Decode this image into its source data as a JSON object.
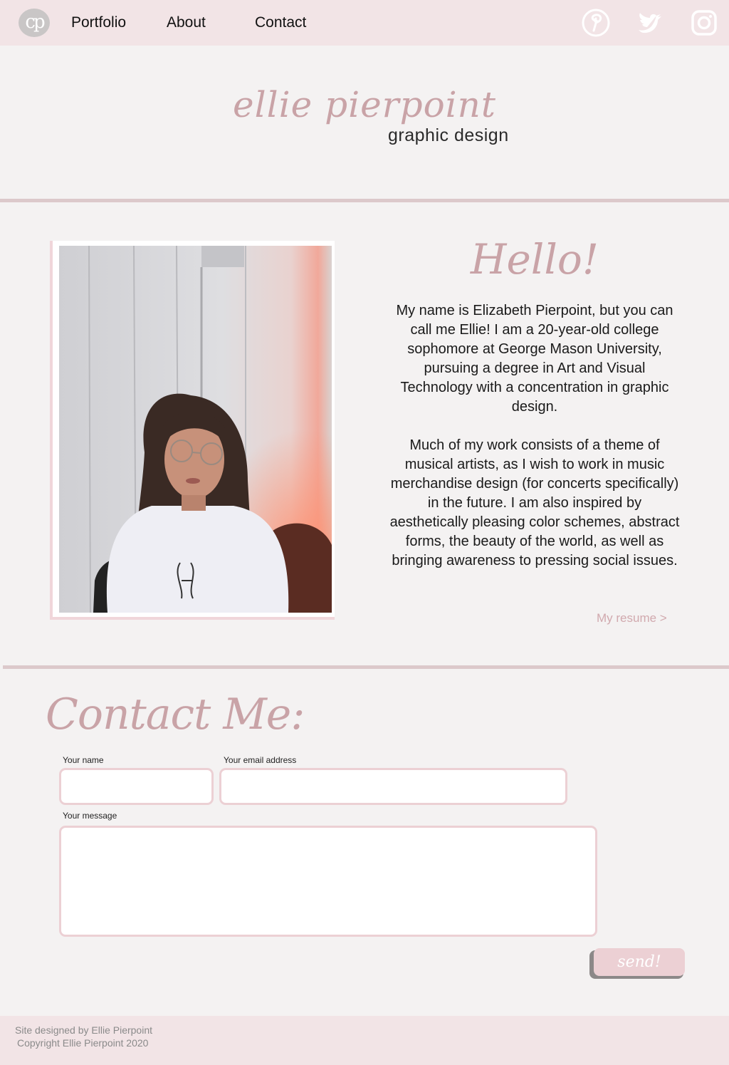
{
  "nav": {
    "logo_text": "cp",
    "links": [
      "Portfolio",
      "About",
      "Contact"
    ],
    "social": [
      "pinterest-icon",
      "twitter-icon",
      "instagram-icon"
    ]
  },
  "header": {
    "name": "ellie pierpoint",
    "subtitle": "graphic design"
  },
  "about": {
    "heading": "Hello!",
    "paragraph_1": "My name is Elizabeth Pierpoint, but you can call me Ellie! I am a 20-year-old college sophomore at George Mason University, pursuing a degree in Art and Visual Technology with a concentration in graphic design.",
    "paragraph_2": "Much of my work consists of a theme of musical artists, as I wish to work in music merchandise design (for concerts specifically) in the future. I am also inspired by aesthetically pleasing color schemes, abstract forms, the beauty of the world, as well as bringing awareness to pressing social issues.",
    "resume_link": "My resume  >"
  },
  "contact": {
    "title": "Contact Me:",
    "name_label": "Your name",
    "email_label": "Your email address",
    "message_label": "Your message",
    "name_value": "",
    "email_value": "",
    "message_value": "",
    "send_label": "send!"
  },
  "footer": {
    "line_1": "Site designed by Ellie Pierpoint",
    "line_2": "Copyright Ellie Pierpoint 2020"
  },
  "colors": {
    "accent_pink": "#c9a3a7",
    "nav_bg": "#f2e4e6",
    "page_bg": "#f4f2f2",
    "divider": "#dcc9cb"
  }
}
